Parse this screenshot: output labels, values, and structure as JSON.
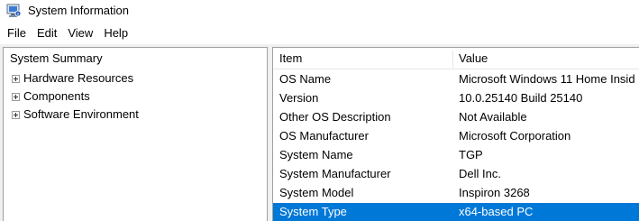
{
  "window": {
    "title": "System Information",
    "icon": "system-information-icon"
  },
  "menu": {
    "items": [
      "File",
      "Edit",
      "View",
      "Help"
    ]
  },
  "tree": {
    "root": "System Summary",
    "children": [
      {
        "label": "Hardware Resources",
        "state": "collapsed"
      },
      {
        "label": "Components",
        "state": "collapsed"
      },
      {
        "label": "Software Environment",
        "state": "collapsed"
      }
    ]
  },
  "list": {
    "columns": {
      "item": "Item",
      "value": "Value"
    },
    "rows": [
      {
        "item": "OS Name",
        "value": "Microsoft Windows 11 Home Insid"
      },
      {
        "item": "Version",
        "value": "10.0.25140 Build 25140"
      },
      {
        "item": "Other OS Description",
        "value": "Not Available"
      },
      {
        "item": "OS Manufacturer",
        "value": "Microsoft Corporation"
      },
      {
        "item": "System Name",
        "value": "TGP"
      },
      {
        "item": "System Manufacturer",
        "value": "Dell Inc."
      },
      {
        "item": "System Model",
        "value": "Inspiron 3268"
      },
      {
        "item": "System Type",
        "value": "x64-based PC"
      }
    ],
    "selected_row": "System Type"
  },
  "colors": {
    "selection": "#0078d7",
    "pane_border": "#a0a0a0",
    "background": "#f0f0f0"
  }
}
